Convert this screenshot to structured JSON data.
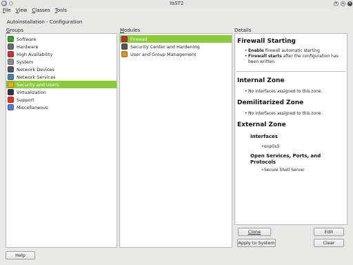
{
  "window": {
    "title": "YaST2"
  },
  "menubar": [
    {
      "label": "File",
      "accel": "F",
      "rest": "ile"
    },
    {
      "label": "View",
      "accel": "V",
      "rest": "iew"
    },
    {
      "label": "Classes",
      "accel": "C",
      "rest": "lasses"
    },
    {
      "label": "Tools",
      "accel": "T",
      "rest": "ools"
    }
  ],
  "header": {
    "module_title": "Autoinstallation - Configuration"
  },
  "groups": {
    "label_accel": "G",
    "label_rest": "roups",
    "items": [
      {
        "label": "Software",
        "icon": "software-icon",
        "color": "#3a9d3a",
        "selected": false
      },
      {
        "label": "Hardware",
        "icon": "hardware-icon",
        "color": "#6a6a6a",
        "selected": false
      },
      {
        "label": "High Availability",
        "icon": "high-availability-icon",
        "color": "#c33",
        "selected": false
      },
      {
        "label": "System",
        "icon": "system-icon",
        "color": "#8a8a8a",
        "selected": false
      },
      {
        "label": "Network Devices",
        "icon": "network-devices-icon",
        "color": "#556",
        "selected": false
      },
      {
        "label": "Network Services",
        "icon": "network-services-icon",
        "color": "#4a7fb0",
        "selected": false
      },
      {
        "label": "Security and Users",
        "icon": "security-users-icon",
        "color": "#e0b020",
        "selected": true
      },
      {
        "label": "Virtualization",
        "icon": "virtualization-icon",
        "color": "#334",
        "selected": false
      },
      {
        "label": "Support",
        "icon": "support-icon",
        "color": "#d33",
        "selected": false
      },
      {
        "label": "Miscellaneous",
        "icon": "miscellaneous-icon",
        "color": "#5a7fc0",
        "selected": false
      }
    ]
  },
  "modules": {
    "label_accel": "M",
    "label_rest": "odules",
    "items": [
      {
        "label": "Firewall",
        "icon": "firewall-icon",
        "color": "#b03a2a",
        "selected": true
      },
      {
        "label": "Security Center and Hardening",
        "icon": "security-center-icon",
        "color": "#555",
        "selected": false
      },
      {
        "label": "User and Group Management",
        "icon": "user-group-icon",
        "color": "#d89030",
        "selected": false
      }
    ]
  },
  "details": {
    "label": "Details",
    "firewall_title": "Firewall Starting",
    "bullet1_bold": "Enable",
    "bullet1_rest": " firewall automatic starting",
    "bullet2_bold1": "Firewall",
    "bullet2_mid": " ",
    "bullet2_bold2": "starts",
    "bullet2_rest": " after the configuration has been written",
    "internal_title": "Internal Zone",
    "internal_text": "No interfaces assigned to this zone.",
    "dmz_title": "Demilitarized Zone",
    "dmz_text": "No interfaces assigned to this zone.",
    "external_title": "External Zone",
    "interfaces_label": "Interfaces",
    "interface_item": "enp0s3",
    "services_label": "Open Services, Ports, and Protocols",
    "service_item": "Secure Shell Server"
  },
  "buttons": {
    "clone": "Clone",
    "edit": "Edit",
    "apply": "Apply to System",
    "clear": "Clear",
    "help": "Help"
  },
  "colors": {
    "selection": "#8bc93d"
  }
}
